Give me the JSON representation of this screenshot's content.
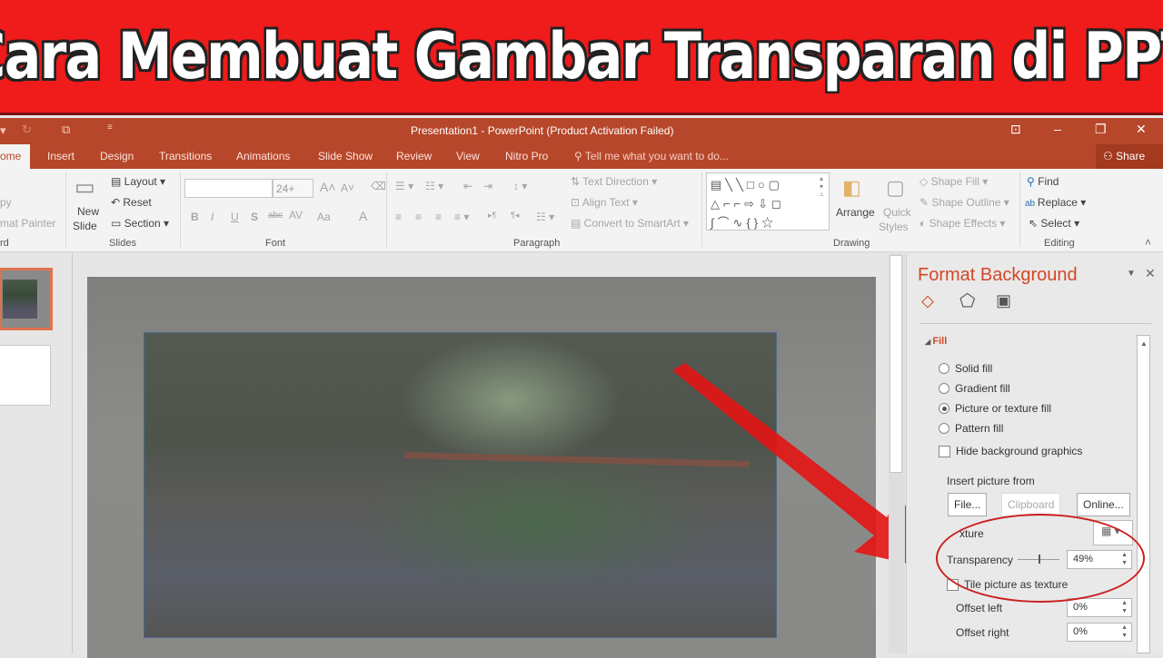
{
  "banner": {
    "title": "Cara Membuat Gambar Transparan di PPT"
  },
  "titlebar": {
    "title": "Presentation1 - PowerPoint (Product Activation Failed)",
    "quick_access": [
      "undo-dropdown",
      "redo",
      "start-from-beginning",
      "customize"
    ]
  },
  "tabs": {
    "items": [
      "ome",
      "Insert",
      "Design",
      "Transitions",
      "Animations",
      "Slide Show",
      "Review",
      "View",
      "Nitro Pro"
    ],
    "active": "ome",
    "tell_me": "Tell me what you want to do...",
    "share": "Share"
  },
  "ribbon": {
    "clipboard": {
      "copy": "py",
      "format_painter": "mat Painter",
      "group": "rd"
    },
    "slides": {
      "new_slide_1": "New",
      "new_slide_2": "Slide",
      "layout": "Layout",
      "reset": "Reset",
      "section": "Section",
      "group": "Slides"
    },
    "font": {
      "size": "24+",
      "bold": "B",
      "italic": "I",
      "underline": "U",
      "shadow": "S",
      "strike": "abc",
      "spacing": "AV",
      "case": "Aa",
      "color": "A",
      "group": "Font"
    },
    "paragraph": {
      "text_direction": "Text Direction",
      "align_text": "Align Text",
      "smartart": "Convert to SmartArt",
      "group": "Paragraph"
    },
    "drawing": {
      "arrange": "Arrange",
      "quick_styles_1": "Quick",
      "quick_styles_2": "Styles",
      "shape_fill": "Shape Fill",
      "shape_outline": "Shape Outline",
      "shape_effects": "Shape Effects",
      "group": "Drawing"
    },
    "editing": {
      "find": "Find",
      "replace": "Replace",
      "select": "Select",
      "group": "Editing"
    }
  },
  "format_pane": {
    "title": "Format Background",
    "section": "Fill",
    "fill_options": [
      {
        "label": "Solid fill",
        "selected": false
      },
      {
        "label": "Gradient fill",
        "selected": false
      },
      {
        "label": "Picture or texture fill",
        "selected": true
      },
      {
        "label": "Pattern fill",
        "selected": false
      }
    ],
    "hide_bg": {
      "label": "Hide background graphics",
      "checked": false
    },
    "insert_from": "Insert picture from",
    "buttons": {
      "file": "File...",
      "clipboard": "Clipboard",
      "online": "Online..."
    },
    "texture_label": "xture",
    "transparency": {
      "label": "Transparency",
      "value": "49%",
      "percent": 49
    },
    "tile": {
      "label": "Tile picture as texture",
      "checked": false
    },
    "offset_left": {
      "label": "Offset left",
      "value": "0%"
    },
    "offset_right": {
      "label": "Offset right",
      "value": "0%"
    }
  }
}
